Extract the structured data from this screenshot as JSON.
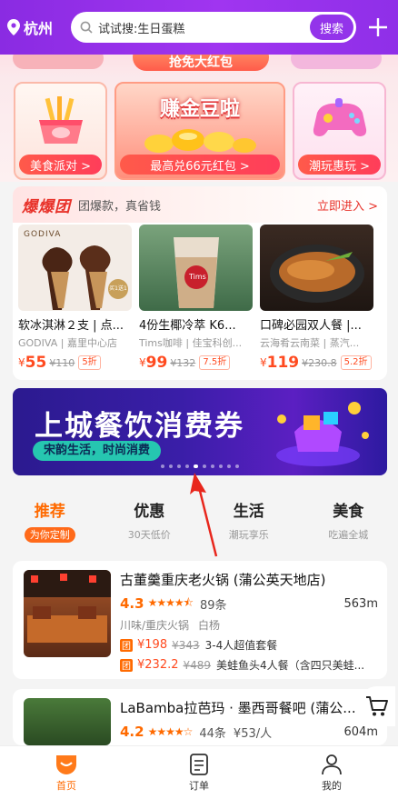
{
  "header": {
    "city": "杭州",
    "search_placeholder": "试试搜:生日蛋糕",
    "search_button": "搜索"
  },
  "promo_strip": {
    "label": "抢免大红包"
  },
  "promo_cards": [
    {
      "label": "美食派对 >"
    },
    {
      "title": "赚金豆啦",
      "label": "最高兑66元红包 >"
    },
    {
      "label": "潮玩惠玩 >"
    }
  ],
  "baobao": {
    "logo": "爆爆团",
    "subtitle": "团爆款，真省钱",
    "more": "立即进入 >",
    "deals": [
      {
        "title": "软冰淇淋２支 | 点...",
        "shop": "GODIVA | 嘉里中心店",
        "yen": "¥",
        "price": "55",
        "orig": "¥110",
        "discount": "5折",
        "brand": "GODIVA",
        "badge": "买1送1"
      },
      {
        "title": "4份生椰冷萃 K6...",
        "shop": "Tims咖啡 | 佳宝科创...",
        "yen": "¥",
        "price": "99",
        "orig": "¥132",
        "discount": "7.5折",
        "brand": "Tims"
      },
      {
        "title": "口碑必园双人餐 |...",
        "shop": "云海肴云南菜 | 蒸汽...",
        "yen": "¥",
        "price": "119",
        "orig": "¥230.8",
        "discount": "5.2折"
      }
    ]
  },
  "banner": {
    "title": "上城餐饮消费券",
    "subtitle": "宋韵生活，时尚消费",
    "dots": 10,
    "active_dot": 4
  },
  "tabs": [
    {
      "label": "推荐",
      "desc": "为你定制",
      "active": true
    },
    {
      "label": "优惠",
      "desc": "30天低价"
    },
    {
      "label": "生活",
      "desc": "潮玩享乐"
    },
    {
      "label": "美食",
      "desc": "吃遍全城"
    }
  ],
  "shops": [
    {
      "name": "古董羹重庆老火锅 (蒲公英天地店)",
      "score": "4.3",
      "stars": "★★★★⯪",
      "reviews": "89条",
      "distance": "563m",
      "categories": [
        "川味/重庆火锅",
        "白杨"
      ],
      "offers": [
        {
          "icon": "团",
          "price": "¥198",
          "orig": "¥343",
          "name": "3-4人超值套餐"
        },
        {
          "icon": "团",
          "price": "¥232.2",
          "orig": "¥489",
          "name": "美蛙鱼头4人餐（含四只美蛙..."
        }
      ]
    },
    {
      "name": "LaBamba拉芭玛 · 墨西哥餐吧 (蒲公...",
      "score": "4.2",
      "stars": "★★★★☆",
      "reviews": "44条",
      "per_person": "¥53/人",
      "distance": "604m"
    }
  ],
  "nav": [
    {
      "label": "首页",
      "icon": "home-icon",
      "active": true
    },
    {
      "label": "订单",
      "icon": "order-icon"
    },
    {
      "label": "我的",
      "icon": "profile-icon"
    }
  ],
  "colors": {
    "header": "#9334ea",
    "accent": "#ff6a00",
    "price": "#ff4a1f",
    "banner": "#3a1ea8",
    "annotation_arrow": "#e8261c"
  }
}
